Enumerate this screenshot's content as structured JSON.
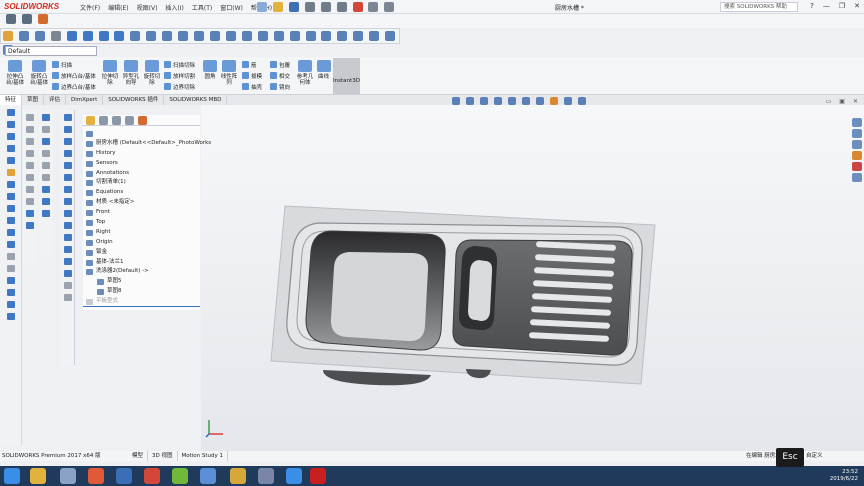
{
  "app": {
    "logo": "SOLIDWORKS",
    "menu": [
      "文件(F)",
      "编辑(E)",
      "视图(V)",
      "插入(I)",
      "工具(T)",
      "窗口(W)",
      "帮助(H)"
    ],
    "document_title": "厨房水槽 *",
    "search_placeholder": "搜索 SOLIDWORKS 帮助",
    "window_controls": [
      "?",
      "—",
      "❐",
      "✕"
    ]
  },
  "configuration": "Default",
  "command_manager": {
    "extrude_boss": "拉伸凸台/基体",
    "revolve_boss": "旋转凸台/基体",
    "sweep": "扫描",
    "loft": "放样凸台/基体",
    "boundary_boss": "边界凸台/基体",
    "extrude_cut": "拉伸切除",
    "hole_wizard": "异型孔向导",
    "revolve_cut": "旋转切除",
    "swept_cut": "扫描切除",
    "lofted_cut": "放样切割",
    "boundary_cut": "边界切除",
    "fillet": "圆角",
    "linear_pattern": "线性阵列",
    "rib": "筋",
    "draft": "拔模",
    "shell": "抽壳",
    "wrap": "包覆",
    "intersect": "相交",
    "mirror": "镜向",
    "reference_geometry": "参考几何体",
    "curves": "曲线",
    "instant3d": "Instant3D"
  },
  "tabs": [
    "特征",
    "草图",
    "评估",
    "DimXpert",
    "SOLIDWORKS 插件",
    "SOLIDWORKS MBD"
  ],
  "feature_tree": {
    "root": "厨房水槽 (Default<<Default>_PhotoWorks",
    "items": [
      {
        "label": "History",
        "muted": false
      },
      {
        "label": "Sensors",
        "muted": false
      },
      {
        "label": "Annotations",
        "muted": false
      },
      {
        "label": "切割清单(1)",
        "muted": false
      },
      {
        "label": "Equations",
        "muted": false
      },
      {
        "label": "材质 <未指定>",
        "muted": false
      },
      {
        "label": "Front",
        "muted": false
      },
      {
        "label": "Top",
        "muted": false
      },
      {
        "label": "Right",
        "muted": false
      },
      {
        "label": "Origin",
        "muted": false
      },
      {
        "label": "钣金",
        "muted": false
      },
      {
        "label": "基体-法兰1",
        "muted": false
      },
      {
        "label": "洗涤器2(Default) ->",
        "muted": false
      },
      {
        "label": "草图5",
        "muted": false
      },
      {
        "label": "草图8",
        "muted": false
      },
      {
        "label": "平板型式",
        "muted": true
      }
    ]
  },
  "status": {
    "left": "SOLIDWORKS Premium 2017 x64 版",
    "tabs": [
      "模型",
      "3D 视图",
      "Motion Study 1"
    ],
    "right": "在编辑 厨房水槽",
    "right2": "自定义"
  },
  "taskbar": {
    "time": "23:52",
    "date": "2019/6/22"
  },
  "overlay": {
    "esc": "Esc"
  },
  "colors": {
    "logo": "#d52b1e",
    "accent": "#3b6fc1",
    "taskbar": "#1f3a5a"
  }
}
